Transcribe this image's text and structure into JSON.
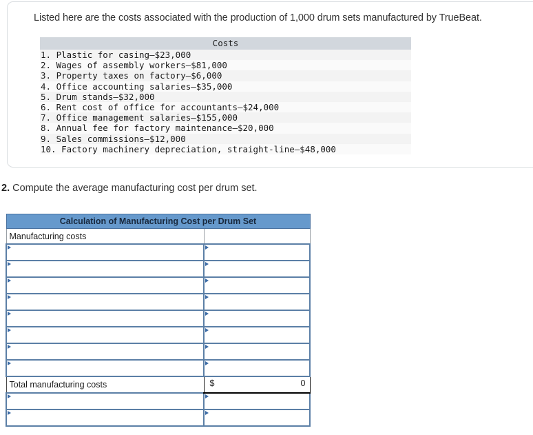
{
  "question_panel": {
    "intro": "Listed here are the costs associated with the production of 1,000 drum sets manufactured by TrueBeat.",
    "costs_header": "Costs",
    "costs": [
      "1. Plastic for casing–$23,000",
      "2. Wages of assembly workers–$81,000",
      "3. Property taxes on factory–$6,000",
      "4. Office accounting salaries–$35,000",
      "5. Drum stands–$32,000",
      "6. Rent cost of office for accountants–$24,000",
      "7. Office management salaries–$155,000",
      "8. Annual fee for factory maintenance–$20,000",
      "9. Sales commissions–$12,000",
      "10. Factory machinery depreciation, straight-line–$48,000"
    ]
  },
  "question2": {
    "number": "2.",
    "prompt": "Compute the average manufacturing cost per drum set.",
    "table": {
      "title": "Calculation of Manufacturing Cost per Drum Set",
      "row_label_manufacturing_costs": "Manufacturing costs",
      "row_label_total": "Total manufacturing costs",
      "total_currency_symbol": "$",
      "total_value": "0",
      "empty_rows_before_total": 8,
      "empty_rows_after_total": 2
    }
  },
  "colors": {
    "table_header_blue": "#6699cc",
    "input_border_blue": "#5b7fa6",
    "marker_blue": "#3c6ba5",
    "costs_header_gray": "#d2d7dd"
  }
}
